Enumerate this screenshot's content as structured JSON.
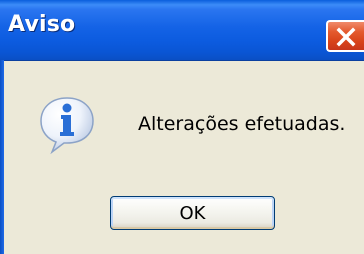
{
  "window": {
    "title": "Aviso",
    "close_icon": "close-icon"
  },
  "dialog": {
    "icon": "information-icon",
    "message": "Alterações efetuadas.",
    "ok_label": "OK"
  },
  "colors": {
    "titlebar_blue": "#0a55d4",
    "close_red": "#d8431a",
    "dialog_background": "#ece9d8",
    "icon_blue": "#2a6fd6"
  }
}
